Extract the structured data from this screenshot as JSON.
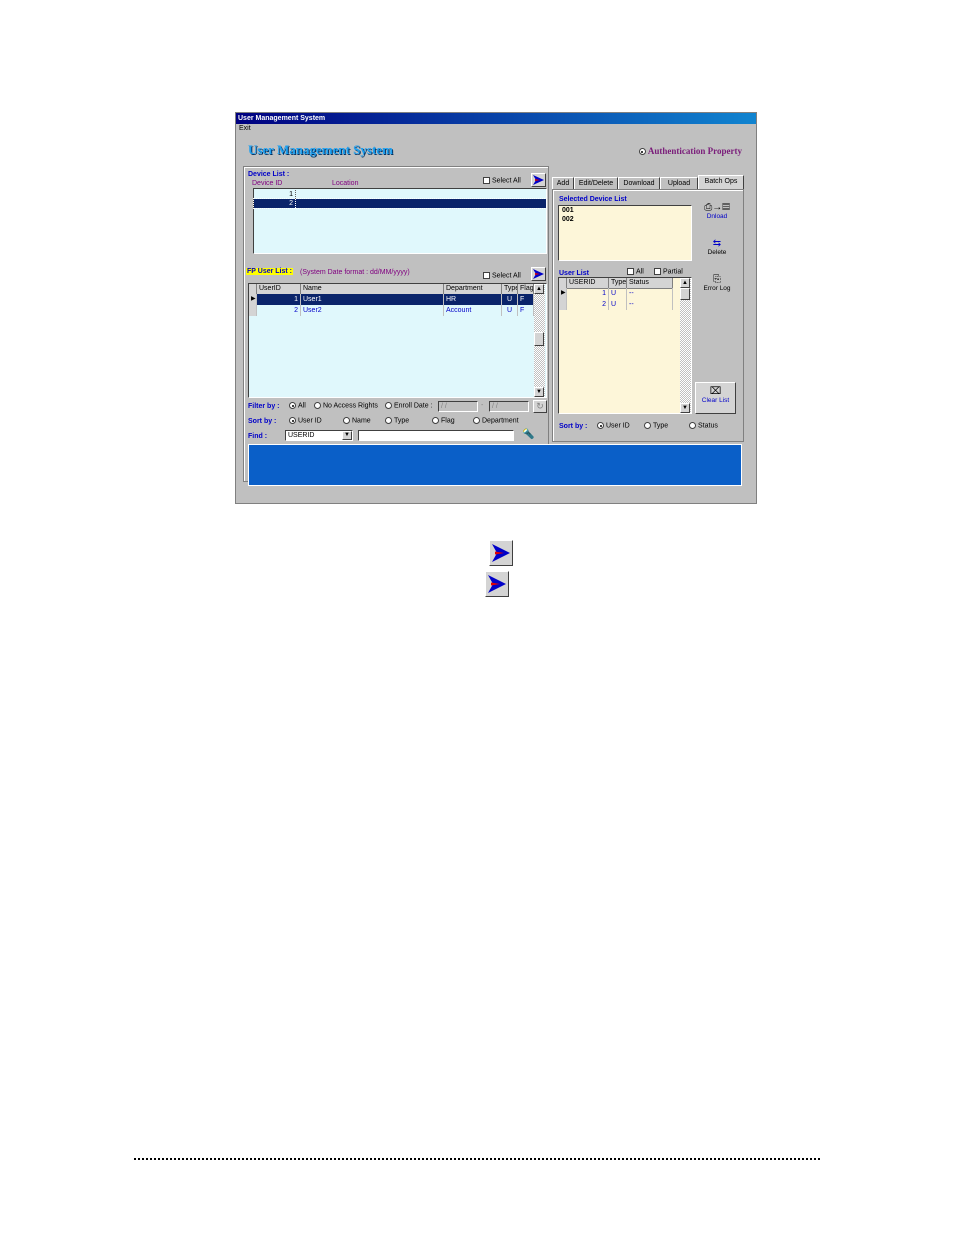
{
  "window": {
    "title": "User Management System",
    "menu": [
      "Exit"
    ]
  },
  "header": {
    "app_title": "User Management System",
    "auth_property": "Authentication Property"
  },
  "device_list": {
    "label": "Device List :",
    "columns": [
      "Device ID",
      "Location"
    ],
    "select_all": "Select All",
    "rows": [
      {
        "id": "1",
        "location": ""
      },
      {
        "id": "2",
        "location": ""
      }
    ]
  },
  "fp_user_list": {
    "label": "FP User List :",
    "date_format": "(System Date format : dd/MM/yyyy)",
    "select_all": "Select All",
    "columns": [
      "UserID",
      "Name",
      "Department",
      "Type",
      "Flag"
    ],
    "rows": [
      {
        "userid": "1",
        "name": "User1",
        "department": "HR",
        "type": "U",
        "flag": "F"
      },
      {
        "userid": "2",
        "name": "User2",
        "department": "Account",
        "type": "U",
        "flag": "F"
      }
    ]
  },
  "filter": {
    "label": "Filter by :",
    "options": [
      "All",
      "No Access Rights",
      "Enroll Date :"
    ],
    "date_from": " /  / ",
    "date_sep": "-",
    "date_to": " /  / "
  },
  "sort": {
    "label": "Sort by :",
    "options": [
      "User ID",
      "Name",
      "Type",
      "Flag",
      "Department"
    ]
  },
  "find": {
    "label": "Find :",
    "field": "USERID",
    "value": ""
  },
  "tabs": [
    "Add",
    "Edit/Delete",
    "Download",
    "Upload",
    "Batch Ops"
  ],
  "batch": {
    "selected_device_label": "Selected Device List",
    "selected_devices": [
      "001",
      "002"
    ],
    "user_list_label": "User List",
    "all_label": "All",
    "partial_label": "Partial",
    "columns": [
      "USERID",
      "Type",
      "Status"
    ],
    "rows": [
      {
        "userid": "1",
        "type": "U",
        "status": "--"
      },
      {
        "userid": "2",
        "type": "U",
        "status": "--"
      }
    ],
    "buttons": {
      "download": "Dnload",
      "delete": "Delete",
      "error_log": "Error Log",
      "clear_list": "Clear List"
    },
    "sort_label": "Sort by :",
    "sort_options": [
      "User ID",
      "Type",
      "Status"
    ]
  },
  "colors": {
    "accent": "#0000c8",
    "selection": "#0a246a",
    "status_bar": "#0a5fc8",
    "list_bg": "#e0f8fc",
    "cream_bg": "#fdf6d9"
  }
}
